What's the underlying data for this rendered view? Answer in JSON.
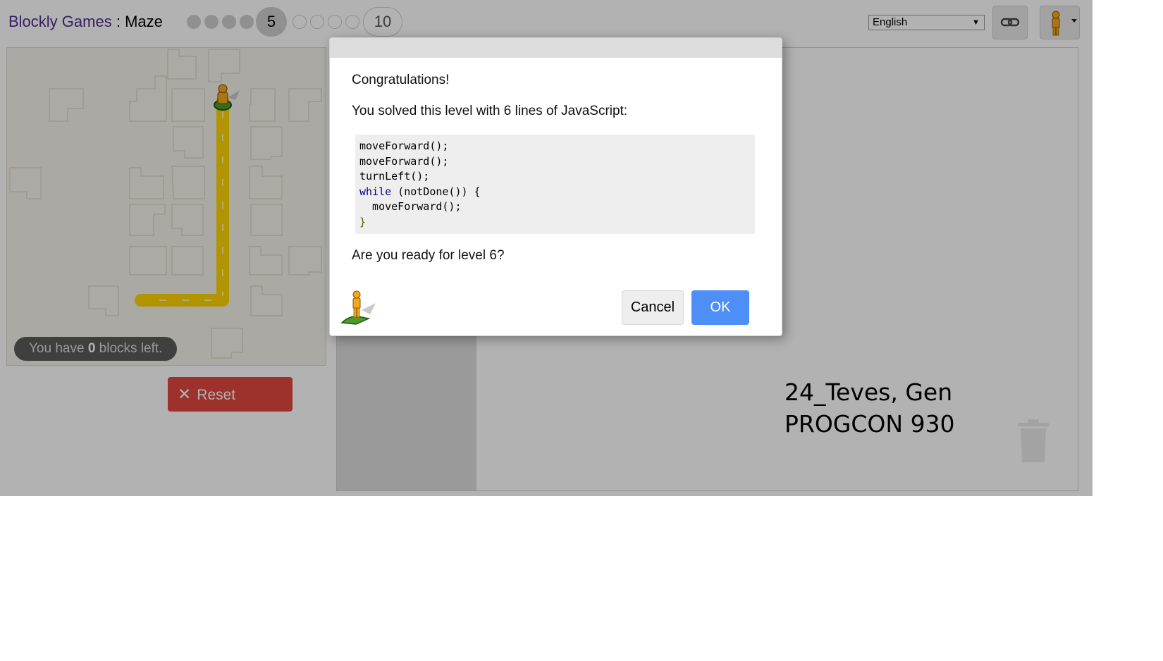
{
  "header": {
    "app_name": "Blockly Games",
    "separator": " : ",
    "game_name": "Maze",
    "current_level": "5",
    "last_level": "10",
    "language": "English"
  },
  "maze": {
    "blocks_left_prefix": "You have ",
    "blocks_left_count": "0",
    "blocks_left_suffix": " blocks left.",
    "reset_label": "Reset"
  },
  "watermark": {
    "line1": "24_Teves, Gen",
    "line2": "PROGCON 930"
  },
  "dialog": {
    "congrats": "Congratulations!",
    "solved": "You solved this level with 6 lines of JavaScript:",
    "code": {
      "line1": "moveForward();",
      "line2": "moveForward();",
      "line3": "turnLeft();",
      "line4_kw": "while",
      "line4_rest": " (notDone()) {",
      "line5": "  moveForward();",
      "line6": "}"
    },
    "ready": "Are you ready for level 6?",
    "cancel_label": "Cancel",
    "ok_label": "OK"
  },
  "icons": {
    "link": "link-icon",
    "avatar": "pegman-icon",
    "trash": "trash-icon",
    "reset": "close-icon"
  },
  "colors": {
    "ok_button": "#4e8ef7",
    "reset_button": "#e0483e",
    "path": "#ffd400",
    "app_link": "#4e2f8f"
  }
}
